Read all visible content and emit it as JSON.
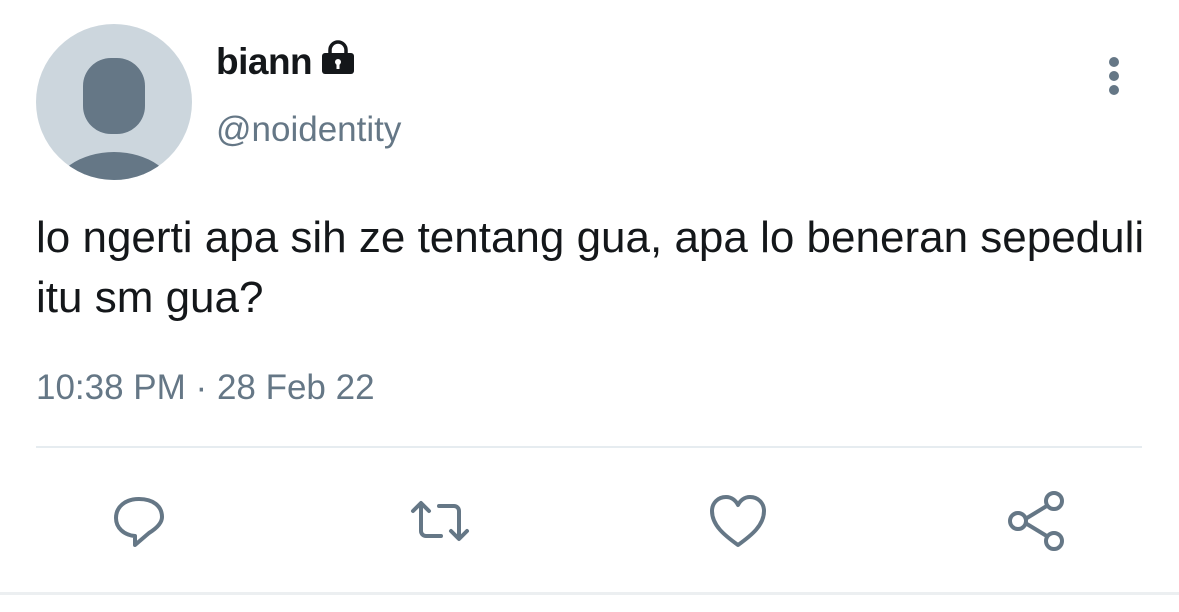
{
  "user": {
    "display_name": "biann",
    "handle": "@noidentity",
    "protected_icon": "lock-icon",
    "avatar": "default-avatar"
  },
  "tweet": {
    "text": "lo ngerti apa sih ze tentang gua, apa lo beneran sepeduli itu sm gua?",
    "time": "10:38 PM",
    "separator": "·",
    "date": "28 Feb 22"
  },
  "actions": [
    {
      "icon": "reply-icon"
    },
    {
      "icon": "retweet-icon"
    },
    {
      "icon": "like-icon"
    },
    {
      "icon": "share-icon"
    }
  ],
  "menu_icon": "more-vertical-icon",
  "colors": {
    "text_primary": "#14171a",
    "text_secondary": "#657786",
    "avatar_bg": "#ccd6dd",
    "avatar_fg": "#657786",
    "divider": "#e6ecf0"
  }
}
